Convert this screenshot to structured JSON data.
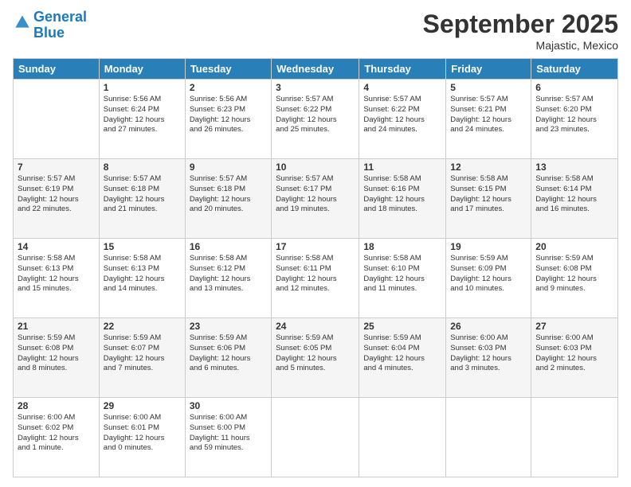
{
  "logo": {
    "line1": "General",
    "line2": "Blue"
  },
  "title": "September 2025",
  "location": "Majastic, Mexico",
  "days_of_week": [
    "Sunday",
    "Monday",
    "Tuesday",
    "Wednesday",
    "Thursday",
    "Friday",
    "Saturday"
  ],
  "weeks": [
    [
      {
        "day": "",
        "info": ""
      },
      {
        "day": "1",
        "info": "Sunrise: 5:56 AM\nSunset: 6:24 PM\nDaylight: 12 hours\nand 27 minutes."
      },
      {
        "day": "2",
        "info": "Sunrise: 5:56 AM\nSunset: 6:23 PM\nDaylight: 12 hours\nand 26 minutes."
      },
      {
        "day": "3",
        "info": "Sunrise: 5:57 AM\nSunset: 6:22 PM\nDaylight: 12 hours\nand 25 minutes."
      },
      {
        "day": "4",
        "info": "Sunrise: 5:57 AM\nSunset: 6:22 PM\nDaylight: 12 hours\nand 24 minutes."
      },
      {
        "day": "5",
        "info": "Sunrise: 5:57 AM\nSunset: 6:21 PM\nDaylight: 12 hours\nand 24 minutes."
      },
      {
        "day": "6",
        "info": "Sunrise: 5:57 AM\nSunset: 6:20 PM\nDaylight: 12 hours\nand 23 minutes."
      }
    ],
    [
      {
        "day": "7",
        "info": "Sunrise: 5:57 AM\nSunset: 6:19 PM\nDaylight: 12 hours\nand 22 minutes."
      },
      {
        "day": "8",
        "info": "Sunrise: 5:57 AM\nSunset: 6:18 PM\nDaylight: 12 hours\nand 21 minutes."
      },
      {
        "day": "9",
        "info": "Sunrise: 5:57 AM\nSunset: 6:18 PM\nDaylight: 12 hours\nand 20 minutes."
      },
      {
        "day": "10",
        "info": "Sunrise: 5:57 AM\nSunset: 6:17 PM\nDaylight: 12 hours\nand 19 minutes."
      },
      {
        "day": "11",
        "info": "Sunrise: 5:58 AM\nSunset: 6:16 PM\nDaylight: 12 hours\nand 18 minutes."
      },
      {
        "day": "12",
        "info": "Sunrise: 5:58 AM\nSunset: 6:15 PM\nDaylight: 12 hours\nand 17 minutes."
      },
      {
        "day": "13",
        "info": "Sunrise: 5:58 AM\nSunset: 6:14 PM\nDaylight: 12 hours\nand 16 minutes."
      }
    ],
    [
      {
        "day": "14",
        "info": "Sunrise: 5:58 AM\nSunset: 6:13 PM\nDaylight: 12 hours\nand 15 minutes."
      },
      {
        "day": "15",
        "info": "Sunrise: 5:58 AM\nSunset: 6:13 PM\nDaylight: 12 hours\nand 14 minutes."
      },
      {
        "day": "16",
        "info": "Sunrise: 5:58 AM\nSunset: 6:12 PM\nDaylight: 12 hours\nand 13 minutes."
      },
      {
        "day": "17",
        "info": "Sunrise: 5:58 AM\nSunset: 6:11 PM\nDaylight: 12 hours\nand 12 minutes."
      },
      {
        "day": "18",
        "info": "Sunrise: 5:58 AM\nSunset: 6:10 PM\nDaylight: 12 hours\nand 11 minutes."
      },
      {
        "day": "19",
        "info": "Sunrise: 5:59 AM\nSunset: 6:09 PM\nDaylight: 12 hours\nand 10 minutes."
      },
      {
        "day": "20",
        "info": "Sunrise: 5:59 AM\nSunset: 6:08 PM\nDaylight: 12 hours\nand 9 minutes."
      }
    ],
    [
      {
        "day": "21",
        "info": "Sunrise: 5:59 AM\nSunset: 6:08 PM\nDaylight: 12 hours\nand 8 minutes."
      },
      {
        "day": "22",
        "info": "Sunrise: 5:59 AM\nSunset: 6:07 PM\nDaylight: 12 hours\nand 7 minutes."
      },
      {
        "day": "23",
        "info": "Sunrise: 5:59 AM\nSunset: 6:06 PM\nDaylight: 12 hours\nand 6 minutes."
      },
      {
        "day": "24",
        "info": "Sunrise: 5:59 AM\nSunset: 6:05 PM\nDaylight: 12 hours\nand 5 minutes."
      },
      {
        "day": "25",
        "info": "Sunrise: 5:59 AM\nSunset: 6:04 PM\nDaylight: 12 hours\nand 4 minutes."
      },
      {
        "day": "26",
        "info": "Sunrise: 6:00 AM\nSunset: 6:03 PM\nDaylight: 12 hours\nand 3 minutes."
      },
      {
        "day": "27",
        "info": "Sunrise: 6:00 AM\nSunset: 6:03 PM\nDaylight: 12 hours\nand 2 minutes."
      }
    ],
    [
      {
        "day": "28",
        "info": "Sunrise: 6:00 AM\nSunset: 6:02 PM\nDaylight: 12 hours\nand 1 minute."
      },
      {
        "day": "29",
        "info": "Sunrise: 6:00 AM\nSunset: 6:01 PM\nDaylight: 12 hours\nand 0 minutes."
      },
      {
        "day": "30",
        "info": "Sunrise: 6:00 AM\nSunset: 6:00 PM\nDaylight: 11 hours\nand 59 minutes."
      },
      {
        "day": "",
        "info": ""
      },
      {
        "day": "",
        "info": ""
      },
      {
        "day": "",
        "info": ""
      },
      {
        "day": "",
        "info": ""
      }
    ]
  ]
}
